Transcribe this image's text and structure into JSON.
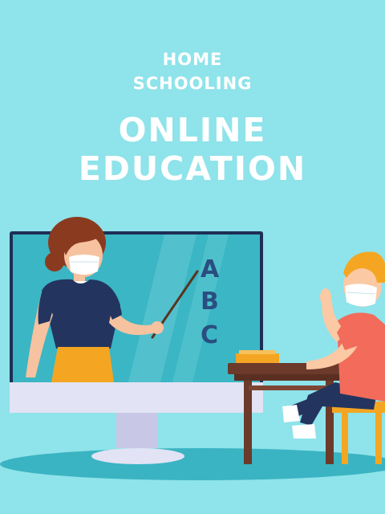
{
  "headline": {
    "line1": "HOME",
    "line2": "SCHOOLING",
    "line3": "ONLINE EDUCATION"
  },
  "board": {
    "letter_a": "A",
    "letter_b": "B",
    "letter_c": "C"
  },
  "colors": {
    "background": "#8fe3ea",
    "screen": "#3bb6c4",
    "monitor_frame": "#1e2f55",
    "monitor_base": "#e2e3f4",
    "desk": "#6b3a2a",
    "teacher_shirt": "#23355f",
    "teacher_skirt": "#f4a623",
    "hair": "#8a3b1f",
    "child_shirt": "#f26b5b",
    "child_hair": "#f4a623",
    "chair": "#f4a623"
  }
}
